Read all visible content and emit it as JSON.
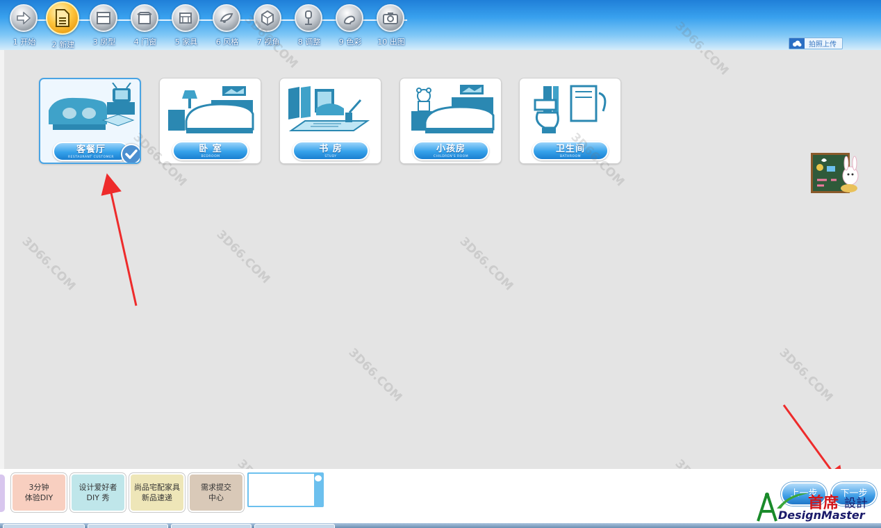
{
  "steps": [
    {
      "label": "1 开始",
      "icon": "arrow-right-icon"
    },
    {
      "label": "2 新建",
      "icon": "new-document-icon",
      "active": true
    },
    {
      "label": "3 房型",
      "icon": "floorplan-icon"
    },
    {
      "label": "4 门窗",
      "icon": "door-window-icon"
    },
    {
      "label": "5 家具",
      "icon": "furniture-icon"
    },
    {
      "label": "6 风格",
      "icon": "style-icon"
    },
    {
      "label": "7 视角",
      "icon": "cube-view-icon"
    },
    {
      "label": "8 调整",
      "icon": "adjust-icon"
    },
    {
      "label": "9 色彩",
      "icon": "color-icon"
    },
    {
      "label": "10 出图",
      "icon": "camera-icon"
    }
  ],
  "upload": {
    "label": "拍照上传",
    "icon": "cloud-icon"
  },
  "rooms": [
    {
      "name": "客餐厅",
      "en": "RESTAURANT CUSTOMER",
      "icon": "living-room-icon",
      "selected": true
    },
    {
      "name": "卧 室",
      "en": "BEDROOM",
      "icon": "bedroom-icon"
    },
    {
      "name": "书 房",
      "en": "STUDY",
      "icon": "study-icon"
    },
    {
      "name": "小孩房",
      "en": "CHILDREN'S ROOM",
      "icon": "kids-room-icon"
    },
    {
      "name": "卫生间",
      "en": "BATHROOM",
      "icon": "bathroom-icon"
    }
  ],
  "quick_buttons": [
    {
      "line1": "3分钟",
      "line2": "体验DIY",
      "color": "#f8cfc0"
    },
    {
      "line1": "设计爱好者",
      "line2": "DIY 秀",
      "color": "#bfe6ea"
    },
    {
      "line1": "尚品宅配家具",
      "line2": "新品速递",
      "color": "#eee6b8"
    },
    {
      "line1": "需求提交",
      "line2": "中心",
      "color": "#d9c9b8"
    }
  ],
  "nav": {
    "prev": "上一步",
    "next": "下一步"
  },
  "brand": {
    "cn1": "首席",
    "cn2": "設計",
    "en": "DesignMaster"
  },
  "watermark": {
    "site": "3D66.COM"
  }
}
